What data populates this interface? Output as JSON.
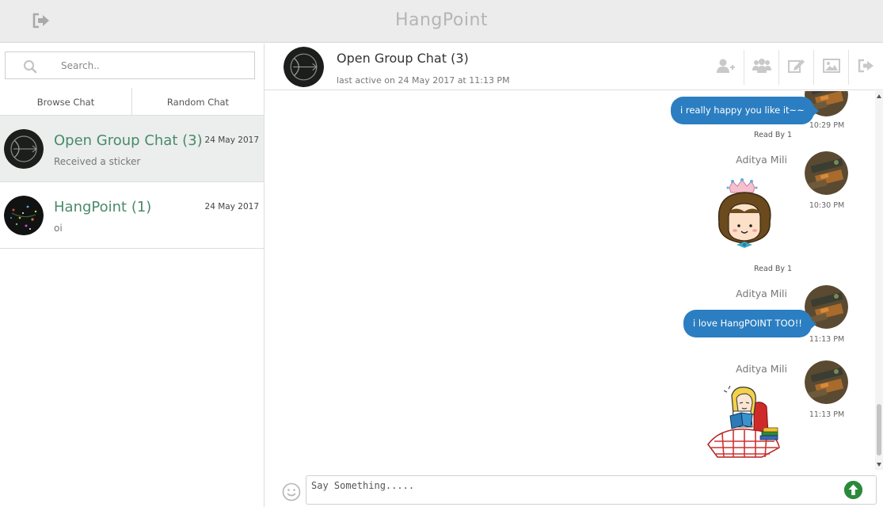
{
  "app": {
    "title": "HangPoint",
    "logout_icon": "sign-out-icon"
  },
  "sidebar": {
    "search": {
      "placeholder": "Search..",
      "value": ""
    },
    "tabs": [
      {
        "label": "Browse Chat"
      },
      {
        "label": "Random Chat"
      }
    ],
    "chats": [
      {
        "name": "Open Group Chat (3)",
        "preview": "Received a sticker",
        "date": "24 May 2017",
        "active": true
      },
      {
        "name": "HangPoint (1)",
        "preview": "oi",
        "date": "24 May 2017",
        "active": false
      }
    ]
  },
  "chat": {
    "name": "Open Group Chat (3)",
    "last_active": "last active on 24 May 2017 at 11:13 PM",
    "actions": [
      "add-user-icon",
      "group-icon",
      "edit-icon",
      "image-icon",
      "leave-icon"
    ],
    "messages": [
      {
        "type": "text",
        "text": "i really happy you like it~~",
        "time": "10:29 PM",
        "read_by": "Read By 1"
      },
      {
        "type": "sticker",
        "sender": "Aditya Mili",
        "sticker": "princess-girl-sticker",
        "time": "10:30 PM",
        "read_by": "Read By 1"
      },
      {
        "type": "text",
        "sender": "Aditya Mili",
        "text": "i love HangPOINT TOO!!",
        "time": "11:13 PM"
      },
      {
        "type": "sticker",
        "sender": "Aditya Mili",
        "sticker": "reading-girl-sticker",
        "time": "11:13 PM"
      }
    ]
  },
  "composer": {
    "placeholder": "Say Something.....",
    "value": "",
    "emoji_icon": "smiley-icon",
    "send_icon": "send-arrow-icon"
  },
  "colors": {
    "accent_green": "#4a8a6a",
    "bubble_blue": "#2b7ec1",
    "send_green": "#2a8a3a"
  }
}
